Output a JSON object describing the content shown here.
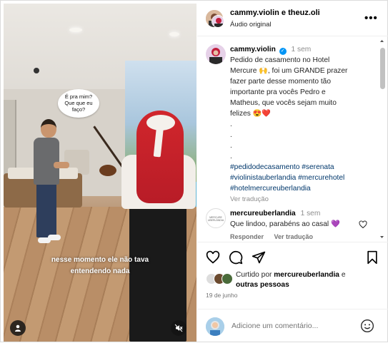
{
  "video": {
    "speech_bubble": [
      "É pra mim?",
      "Que que eu",
      "faço?"
    ],
    "subtitle": [
      "nesse momento ele não tava",
      "entendendo nada"
    ],
    "account_icon": "person-icon",
    "mute_icon": "speaker-muted-icon"
  },
  "header": {
    "usernames": "cammy.violin e theuz.oli",
    "audio": "Áudio original",
    "more_icon": "more-horizontal-icon"
  },
  "caption": {
    "username": "cammy.violin",
    "time": "1 sem",
    "text_lines": [
      "Pedido de casamento no Hotel",
      "Mercure 🙌, foi um GRANDE prazer",
      "fazer parte desse momento tão",
      "importante pra vocês Pedro e",
      "Matheus, que vocês sejam muito",
      "felizes 😍❤️",
      ".",
      ".",
      ".",
      "."
    ],
    "hashtags": [
      "#pedidodecasamento #serenata",
      "#violinistauberlandia #mercurehotel",
      "#hotelmercureuberlandia"
    ],
    "translate": "Ver tradução"
  },
  "comment": {
    "avatar_text": "MERCURE UBERLÂNDIA",
    "username": "mercureuberlandia",
    "time": "1 sem",
    "text": "Que lindoo, parabéns ao casal 💜",
    "reply": "Responder",
    "translate": "Ver tradução"
  },
  "actions": {
    "like_icon": "heart-icon",
    "comment_icon": "comment-icon",
    "share_icon": "send-icon",
    "save_icon": "bookmark-icon"
  },
  "likes": {
    "prefix": "Curtido por",
    "user": "mercureuberlandia",
    "suffix": "e",
    "others": "outras pessoas"
  },
  "date": "19 de junho",
  "add_comment": {
    "placeholder": "Adicione um comentário...",
    "emoji_icon": "smiley-icon"
  },
  "colors": {
    "link": "#00376b",
    "verified": "#0095f6",
    "muted": "#737373",
    "heart": "#e0245e"
  }
}
